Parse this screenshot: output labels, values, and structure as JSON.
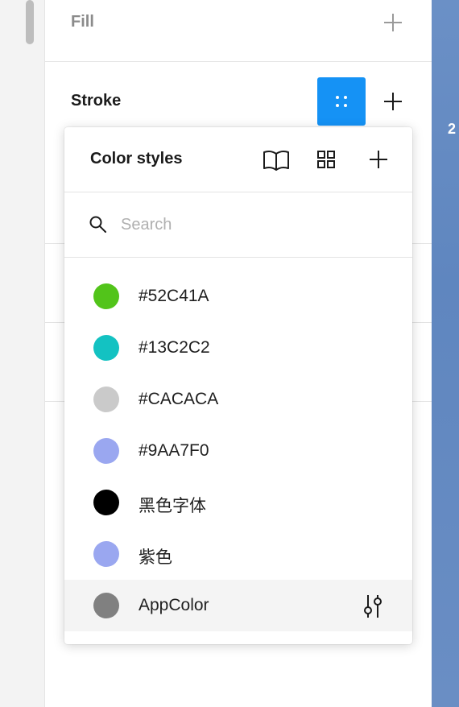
{
  "sections": {
    "fill_label": "Fill",
    "stroke_label": "Stroke"
  },
  "popover": {
    "title": "Color styles",
    "search_placeholder": "Search",
    "search_value": "",
    "styles": [
      {
        "name": "#52C41A",
        "color": "#52C41A"
      },
      {
        "name": "#13C2C2",
        "color": "#13C2C2"
      },
      {
        "name": "#CACACA",
        "color": "#CACACA"
      },
      {
        "name": "#9AA7F0",
        "color": "#9AA7F0"
      },
      {
        "name": "黑色字体",
        "color": "#000000"
      },
      {
        "name": "紫色",
        "color": "#9AA7F0"
      },
      {
        "name": "AppColor",
        "color": "#808080"
      }
    ]
  },
  "canvas": {
    "visible_text": "2"
  },
  "colors": {
    "accent": "#1592F5"
  },
  "icons": {
    "header": [
      "book-icon",
      "grid-icon",
      "plus-icon"
    ],
    "stroke": [
      "style-dots-icon",
      "plus-icon"
    ],
    "search": "search-icon",
    "item_action": "sliders-icon"
  }
}
